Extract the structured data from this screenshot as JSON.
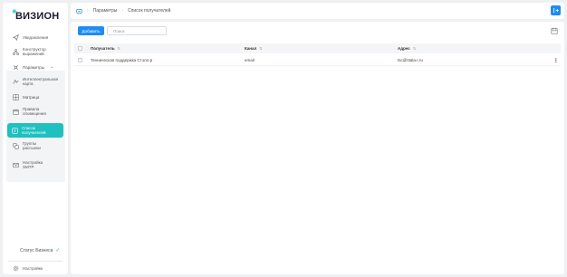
{
  "sidebar": {
    "logo": "ВИЗИОН",
    "items": [
      {
        "label": "Уведомления",
        "icon": "send-icon"
      },
      {
        "label": "Конструктор выражений",
        "icon": "flow-icon"
      },
      {
        "label": "Параметры",
        "icon": "settings-icon"
      },
      {
        "label": "Интеллектуальная карта",
        "icon": "map-icon"
      },
      {
        "label": "Матрица",
        "icon": "grid-icon"
      },
      {
        "label": "Правила оповещения",
        "icon": "calendar-icon"
      },
      {
        "label": "Список получателей",
        "icon": "list-icon"
      },
      {
        "label": "Группы рассылки",
        "icon": "group-icon"
      },
      {
        "label": "Настройка SMTP",
        "icon": "mail-icon"
      }
    ],
    "status_label": "Статус Бизнеса",
    "settings_label": "Настройки"
  },
  "topbar": {
    "breadcrumbs": [
      "Параметры",
      "Список получателей"
    ]
  },
  "toolbar": {
    "add_label": "Добавить",
    "search_placeholder": "Поиск"
  },
  "table": {
    "columns": [
      "Получатель",
      "Канал",
      "Адрес"
    ],
    "rows": [
      {
        "recipient": "Техническая поддержка Стэлл-р",
        "channel": "email",
        "address": "tsc@stala-r.ru"
      }
    ]
  },
  "colors": {
    "accent": "#1ec0c0",
    "primary": "#1f8cf0",
    "status_ok": "#3cc46b"
  }
}
